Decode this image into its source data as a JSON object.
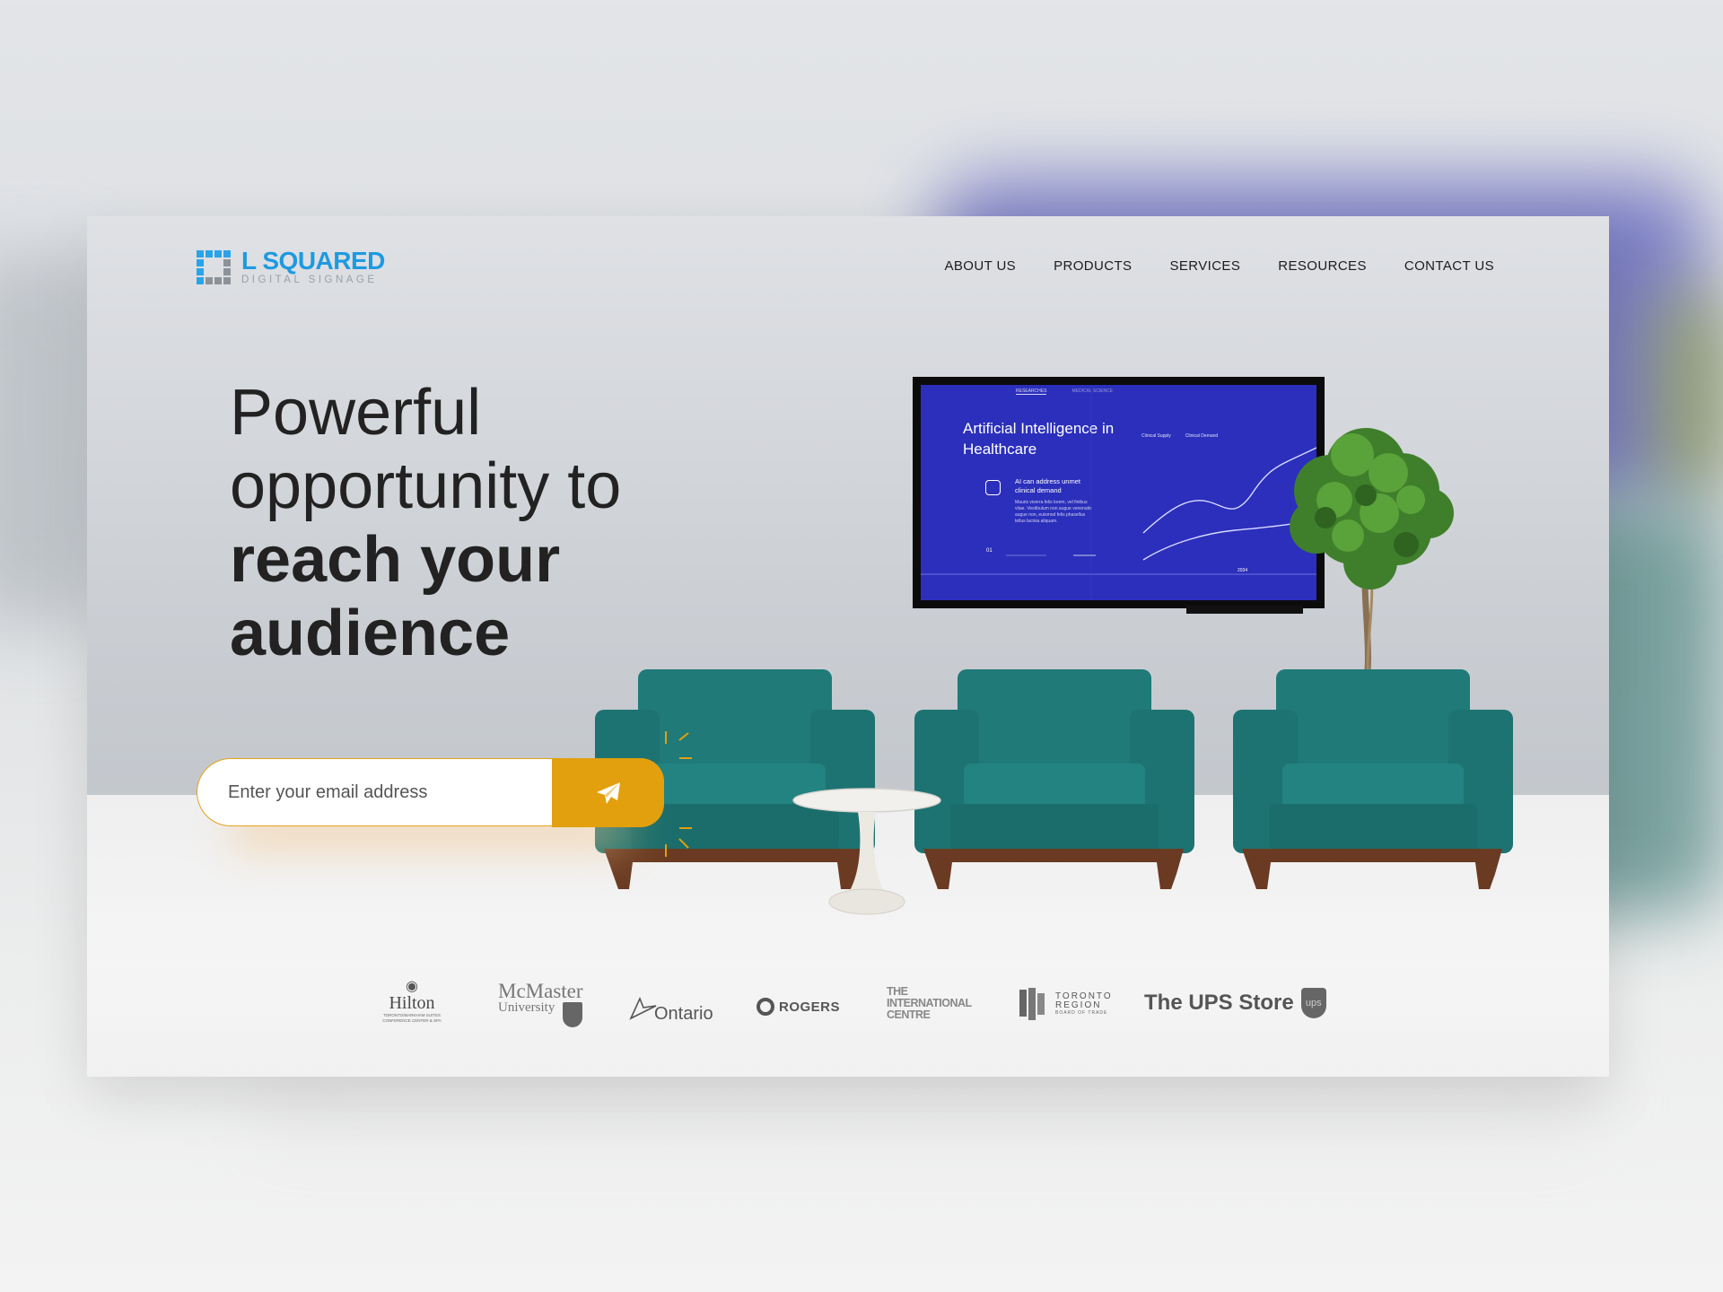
{
  "brand": {
    "name": "L SQUARED",
    "tagline": "DIGITAL SIGNAGE",
    "accent": "#1e9ae0"
  },
  "nav": {
    "items": [
      {
        "label": "ABOUT US"
      },
      {
        "label": "PRODUCTS"
      },
      {
        "label": "SERVICES"
      },
      {
        "label": "RESOURCES"
      },
      {
        "label": "CONTACT US"
      }
    ]
  },
  "hero": {
    "line1": "Powerful",
    "line2": "opportunity to",
    "line3": "reach your",
    "line4": "audience"
  },
  "signup": {
    "placeholder": "Enter your email address",
    "button_icon": "paper-plane-icon",
    "button_color": "#e2a00e"
  },
  "tv_screen": {
    "tab1": "RESEARCHES",
    "tab2": "MEDICAL SCIENCE",
    "title": "Artificial Intelligence in Healthcare",
    "legend1": "Clinical Supply",
    "legend2": "Clinical Demand",
    "subtitle": "AI can address unmet clinical demand",
    "body": "Mauris viverra felis lorem, vel finibus vitae. Vestibulum non augue venenatis augue non, euismod felis phasellus tellus lacinia aliquam.",
    "page": "01",
    "year": "2034",
    "bg_color": "#2b2fbb"
  },
  "client_logos": [
    {
      "name": "Hilton",
      "caption": "TORONTO/MARKHAM SUITES CONFERENCE CENTER & SPA"
    },
    {
      "name": "McMaster",
      "caption": "University"
    },
    {
      "name": "Ontario"
    },
    {
      "name": "ROGERS"
    },
    {
      "name": "THE INTERNATIONAL CENTRE"
    },
    {
      "name": "TORONTO REGION",
      "caption": "BOARD OF TRADE"
    },
    {
      "name": "The UPS Store",
      "badge": "ups"
    }
  ],
  "colors": {
    "chair": "#1f7a78",
    "chair_legs": "#6a3a22",
    "floor": "#f2f2f2",
    "wall": "#c3c7cc"
  }
}
